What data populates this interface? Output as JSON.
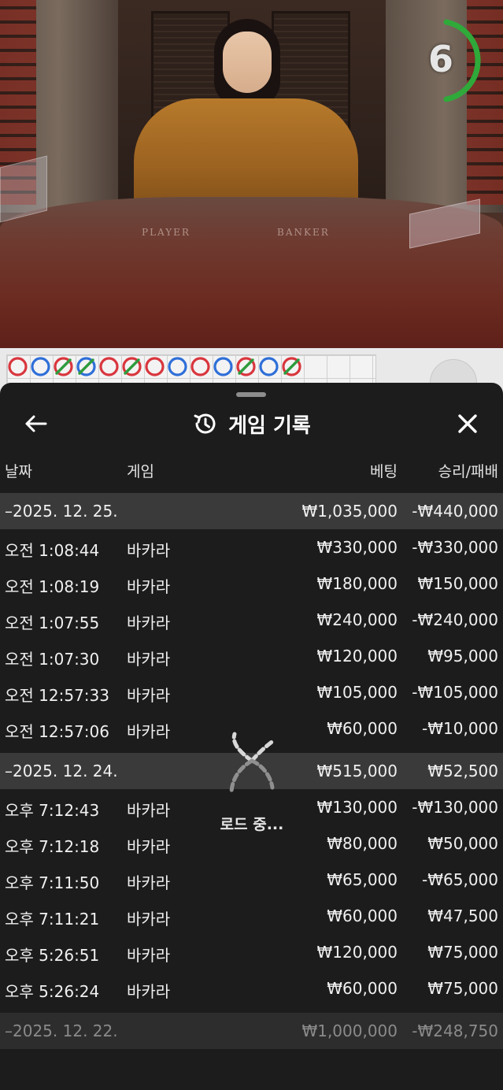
{
  "video": {
    "felt_player": "PLAYER",
    "felt_banker": "BANKER",
    "countdown": "6"
  },
  "roadmap": {
    "cells": [
      "banker",
      "player",
      "tie-banker",
      "tie-player",
      "banker",
      "tie-banker",
      "banker",
      "player",
      "banker",
      "player",
      "tie-banker",
      "player",
      "tie-banker"
    ]
  },
  "sheet": {
    "title": "게임 기록",
    "columns": {
      "date": "날짜",
      "game": "게임",
      "bet": "베팅",
      "win": "승리/패배"
    },
    "groups": [
      {
        "date": "–2025. 12. 25.",
        "bet": "₩1,035,000",
        "win": "-₩440,000",
        "rows": [
          {
            "time": "오전 1:08:44",
            "game": "바카라",
            "bet": "₩330,000",
            "win": "-₩330,000"
          },
          {
            "time": "오전 1:08:19",
            "game": "바카라",
            "bet": "₩180,000",
            "win": "₩150,000"
          },
          {
            "time": "오전 1:07:55",
            "game": "바카라",
            "bet": "₩240,000",
            "win": "-₩240,000"
          },
          {
            "time": "오전 1:07:30",
            "game": "바카라",
            "bet": "₩120,000",
            "win": "₩95,000"
          },
          {
            "time": "오전 12:57:33",
            "game": "바카라",
            "bet": "₩105,000",
            "win": "-₩105,000"
          },
          {
            "time": "오전 12:57:06",
            "game": "바카라",
            "bet": "₩60,000",
            "win": "-₩10,000"
          }
        ]
      },
      {
        "date": "–2025. 12. 24.",
        "bet": "₩515,000",
        "win": "₩52,500",
        "rows": [
          {
            "time": "오후 7:12:43",
            "game": "바카라",
            "bet": "₩130,000",
            "win": "-₩130,000"
          },
          {
            "time": "오후 7:12:18",
            "game": "바카라",
            "bet": "₩80,000",
            "win": "₩50,000"
          },
          {
            "time": "오후 7:11:50",
            "game": "바카라",
            "bet": "₩65,000",
            "win": "-₩65,000"
          },
          {
            "time": "오후 7:11:21",
            "game": "바카라",
            "bet": "₩60,000",
            "win": "₩47,500"
          },
          {
            "time": "오후 5:26:51",
            "game": "바카라",
            "bet": "₩120,000",
            "win": "₩75,000"
          },
          {
            "time": "오후 5:26:24",
            "game": "바카라",
            "bet": "₩60,000",
            "win": "₩75,000"
          }
        ]
      },
      {
        "date": "–2025. 12. 22.",
        "bet": "₩1,000,000",
        "win": "-₩248,750",
        "rows": []
      }
    ],
    "loading_text": "로드 중..."
  },
  "icons": {
    "back": "arrow-left-icon",
    "close": "close-icon",
    "history": "history-icon",
    "loader": "spinner-icon"
  },
  "colors": {
    "banker": "#d9363e",
    "player": "#2f6fd8",
    "tie": "#2e9b3d",
    "countdown_ring": "#2faa3a"
  }
}
